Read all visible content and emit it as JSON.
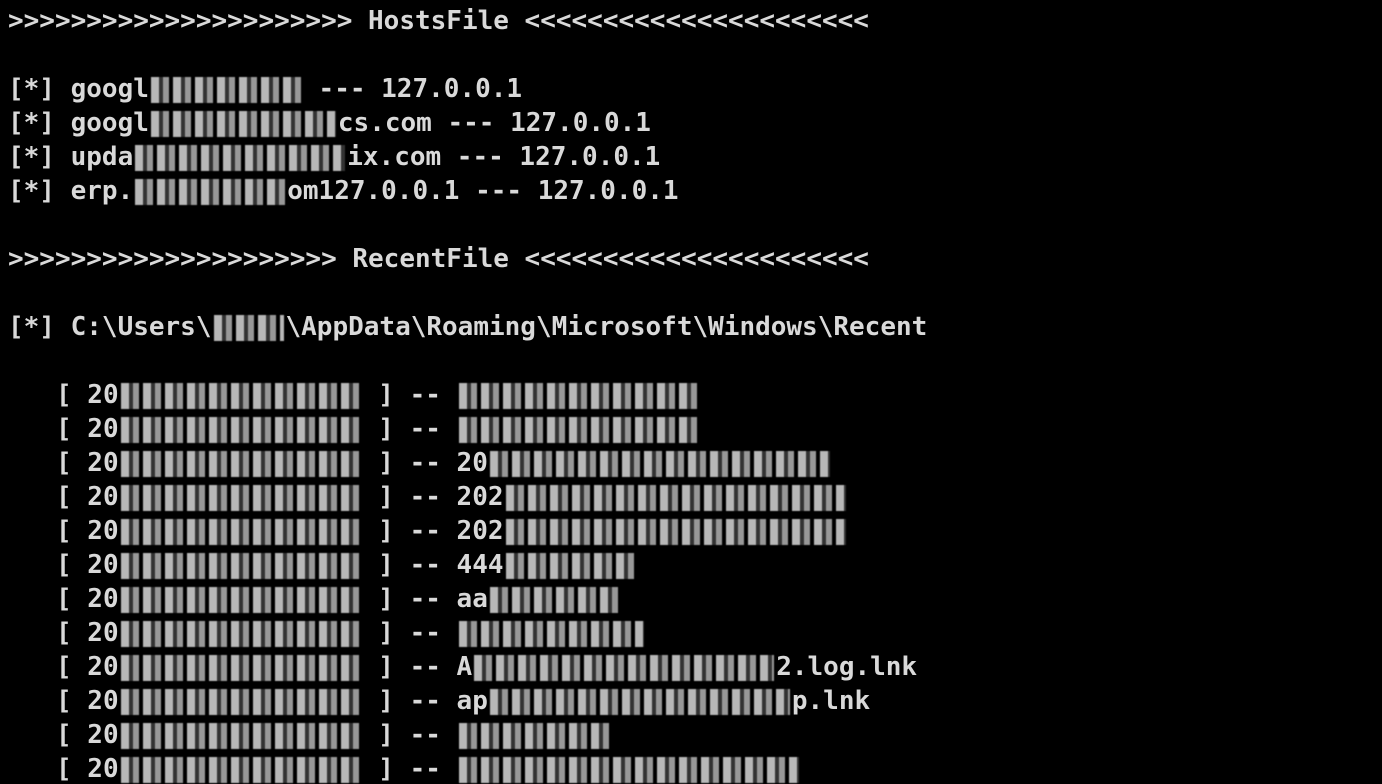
{
  "hosts_section": {
    "header": ">>>>>>>>>>>>>>>>>>>>>> HostsFile <<<<<<<<<<<<<<<<<<<<<<",
    "entries": [
      {
        "prefix": "[*] googl",
        "suffix": " --- 127.0.0.1"
      },
      {
        "prefix": "[*] googl",
        "suffix": "cs.com --- 127.0.0.1"
      },
      {
        "prefix": "[*] upda",
        "suffix": "ix.com --- 127.0.0.1"
      },
      {
        "prefix": "[*] erp.",
        "suffix": "om127.0.0.1 --- 127.0.0.1"
      }
    ]
  },
  "recent_section": {
    "header": ">>>>>>>>>>>>>>>>>>>>> RecentFile <<<<<<<<<<<<<<<<<<<<<<",
    "path_prefix": "[*] C:\\Users\\",
    "path_suffix": "\\AppData\\Roaming\\Microsoft\\Windows\\Recent",
    "files": [
      {
        "open": "[ 20",
        "mid": " ] -- ",
        "tail": ""
      },
      {
        "open": "[ 20",
        "mid": " ] -- ",
        "tail": ""
      },
      {
        "open": "[ 20",
        "mid": " ] -- 20",
        "tail": ""
      },
      {
        "open": "[ 20",
        "mid": " ] -- 202",
        "tail": ""
      },
      {
        "open": "[ 20",
        "mid": " ] -- 202",
        "tail": ""
      },
      {
        "open": "[ 20",
        "mid": " ] -- 444",
        "tail": ""
      },
      {
        "open": "[ 20",
        "mid": " ] -- aa",
        "tail": ""
      },
      {
        "open": "[ 20",
        "mid": " ] -- ",
        "tail": ""
      },
      {
        "open": "[ 20",
        "mid": " ] -- A",
        "tail": "2.log.lnk"
      },
      {
        "open": "[ 20",
        "mid": " ] -- ap",
        "tail": "p.lnk"
      },
      {
        "open": "[ 20",
        "mid": " ] -- ",
        "tail": ""
      },
      {
        "open": "[ 20",
        "mid": " ] -- ",
        "tail": ""
      }
    ]
  },
  "colors": {
    "background": "#000000",
    "text": "#d9d9d9"
  }
}
